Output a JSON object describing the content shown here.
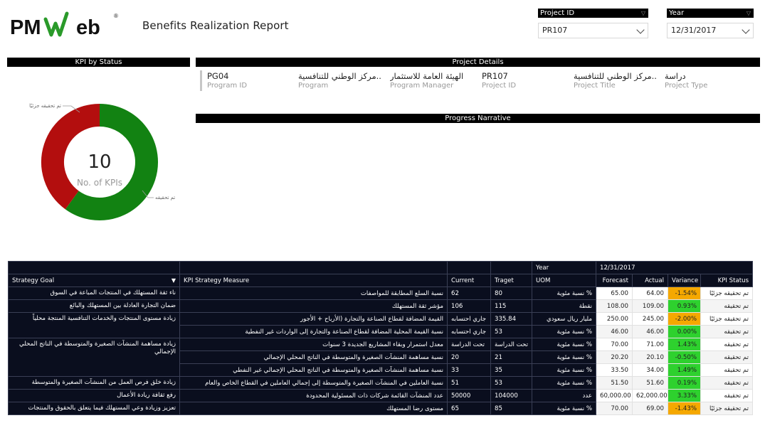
{
  "header": {
    "logo_text": "PMWeb",
    "report_title": "Benefits Realization Report"
  },
  "slicers": {
    "project_id": {
      "label": "Project ID",
      "value": "PR107"
    },
    "year": {
      "label": "Year",
      "value": "12/31/2017"
    }
  },
  "kpi_by_status": {
    "title": "KPI by Status",
    "total": "10",
    "caption": "No. of KPIs",
    "segments": [
      {
        "label": "تم تحقيقه",
        "count": 6,
        "color": "#128212"
      },
      {
        "label": "تم تحقيقه جزئيًا",
        "count": 4,
        "color": "#b30e0e"
      }
    ]
  },
  "project_details": {
    "title": "Project Details",
    "fields": [
      {
        "value": "PG04",
        "label": "Program ID"
      },
      {
        "value": "مركز الوطني للتنافسية..",
        "label": "Program"
      },
      {
        "value": "الهيئة العامة للاستثمار",
        "label": "Program Manager"
      },
      {
        "value": "PR107",
        "label": "Project ID"
      },
      {
        "value": "مركز الوطني للتنافسية..",
        "label": "Project Title"
      },
      {
        "value": "دراسة",
        "label": "Project Type"
      }
    ]
  },
  "progress_narrative": {
    "title": "Progress Narrative"
  },
  "table": {
    "year_label": "Year",
    "year_value": "12/31/2017",
    "headers": {
      "goal": "Strategy Goal",
      "measure": "KPI Strategy Measure",
      "current": "Current",
      "target": "Traget",
      "uom": "UOM",
      "forecast": "Forecast",
      "actual": "Actual",
      "variance": "Variance",
      "status": "KPI Status"
    },
    "goals": [
      {
        "text": "ناء ثقة المستهلك في المنتجات المباعة في السوق",
        "span": 1
      },
      {
        "text": "ضمان التجارة العادلة بين المستهلك والبائع",
        "span": 1
      },
      {
        "text": "زيادة مستوى المنتجات والخدمات التنافسية المنتجة محلياً",
        "span": 2
      },
      {
        "text": "زيادة مساهمة المنشآت الصغيرة والمتوسطة في الناتج المحلي الإجمالي",
        "span": 3
      },
      {
        "text": "زيادة خلق فرص العمل من المنشآت الصغيرة والمتوسطة",
        "span": 1
      },
      {
        "text": "رفع ثقافة ريادة الأعمال",
        "span": 1
      },
      {
        "text": "تعزيز وزيادة وعي المستهلك فيما يتعلق بالحقوق والمنتجات",
        "span": 1
      }
    ],
    "rows": [
      {
        "measure": "نسبة السلع المطابقة للمواصفات",
        "current": "62",
        "target": "80",
        "uom": "% نسبة مئوية",
        "forecast": "65.00",
        "actual": "64.00",
        "variance": "-1.54%",
        "variance_color": "#f5a800",
        "status": "تم تحقيقه جزئيًا"
      },
      {
        "measure": "مؤشر ثقة المستهلك",
        "current": "106",
        "target": "115",
        "uom": "نقطة",
        "forecast": "108.00",
        "actual": "109.00",
        "variance": "0.93%",
        "variance_color": "#2ed12e",
        "status": "تم تحقيقه"
      },
      {
        "measure": "القيمة المضافة لقطاع الصناعة والتجارة (الأرباح + الأجور",
        "current": "جاري احتسابه",
        "target": "335.84",
        "uom": "مليار ريال سعودي",
        "forecast": "250.00",
        "actual": "245.00",
        "variance": "-2.00%",
        "variance_color": "#f5a800",
        "status": "تم تحقيقه جزئيًا"
      },
      {
        "measure": "نسبة القيمة المحلية المضافة لقطاع الصناعة والتجارة إلى الواردات غير النفطية",
        "current": "جاري احتسابه",
        "target": "53",
        "uom": "% نسبة مئوية",
        "forecast": "46.00",
        "actual": "46.00",
        "variance": "0.00%",
        "variance_color": "#2ed12e",
        "status": "تم تحقيقه"
      },
      {
        "measure": "معدل استمرار وبقاء المشاريع الجديدة 3 سنوات",
        "current": "تحت الدراسة",
        "target": "تحت الدراسة",
        "uom": "% نسبة مئوية",
        "forecast": "70.00",
        "actual": "71.00",
        "variance": "1.43%",
        "variance_color": "#2ed12e",
        "status": "تم تحقيقه"
      },
      {
        "measure": "نسبة مساهمة المنشآت الصغيرة والمتوسطة في الناتج المحلي الإجمالي",
        "current": "20",
        "target": "21",
        "uom": "% نسبة مئوية",
        "forecast": "20.20",
        "actual": "20.10",
        "variance": "-0.50%",
        "variance_color": "#2ed12e",
        "status": "تم تحقيقه"
      },
      {
        "measure": "نسبة مساهمة المنشآت الصغيرة والمتوسطة في الناتج المحلي الإجمالي غير النفطي",
        "current": "33",
        "target": "35",
        "uom": "% نسبة مئوية",
        "forecast": "33.50",
        "actual": "34.00",
        "variance": "1.49%",
        "variance_color": "#2ed12e",
        "status": "تم تحقيقه"
      },
      {
        "measure": "نسبة العاملين في المنشآت الصغيرة والمتوسطة إلى إجمالي العاملين في القطاع الخاص والعام",
        "current": "51",
        "target": "53",
        "uom": "% نسبة مئوية",
        "forecast": "51.50",
        "actual": "51.60",
        "variance": "0.19%",
        "variance_color": "#2ed12e",
        "status": "تم تحقيقه"
      },
      {
        "measure": "عدد المنشآت القائمة شركات ذات المسئولية المحدودة",
        "current": "50000",
        "target": "104000",
        "uom": "عدد",
        "forecast": "60,000.00",
        "actual": "62,000.00",
        "variance": "3.33%",
        "variance_color": "#2ed12e",
        "status": "تم تحقيقه"
      },
      {
        "measure": "مستوى رضا المستهلك",
        "current": "65",
        "target": "85",
        "uom": "% نسبة مئوية",
        "forecast": "70.00",
        "actual": "69.00",
        "variance": "-1.43%",
        "variance_color": "#f5a800",
        "status": "تم تحقيقه جزئيًا"
      }
    ]
  }
}
